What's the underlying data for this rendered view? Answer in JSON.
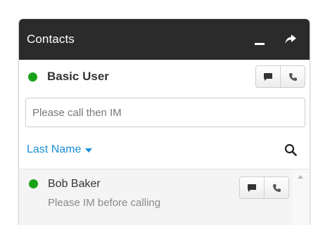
{
  "header": {
    "title": "Contacts",
    "minimize_icon": "minimize-icon",
    "popout_icon": "share-arrow-icon"
  },
  "user": {
    "name": "Basic User",
    "presence": "available",
    "presence_color": "#1aa31a",
    "chat_icon": "chat-icon",
    "phone_icon": "phone-icon"
  },
  "status_field": {
    "placeholder": "Please call then IM",
    "value": ""
  },
  "sort": {
    "label": "Last Name",
    "search_icon": "search-icon",
    "accent_color": "#1a8fd6"
  },
  "contacts": [
    {
      "name": "Bob Baker",
      "status": "Please IM before calling",
      "presence": "available"
    }
  ]
}
